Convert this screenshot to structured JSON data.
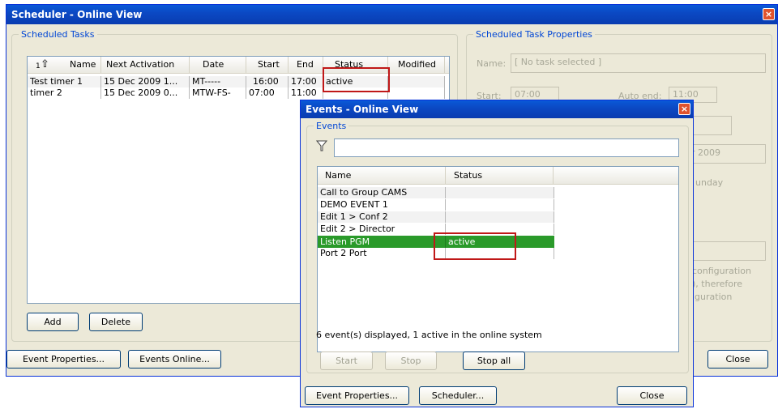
{
  "scheduler": {
    "title": "Scheduler - Online View",
    "tasks_legend": "Scheduled Tasks",
    "columns": [
      "Name",
      "Next Activation",
      "Date",
      "Start",
      "End",
      "Status",
      "Modified"
    ],
    "sort_indicator": "1",
    "rows": [
      {
        "name": "Test timer 1",
        "next": "15 Dec 2009 1...",
        "date": "MT-----",
        "start": "16:00",
        "end": "17:00",
        "status": "active"
      },
      {
        "name": "timer 2",
        "next": "15 Dec 2009 0...",
        "date": "MTW-FS-",
        "start": "07:00",
        "end": "11:00",
        "status": ""
      }
    ],
    "add_label": "Add",
    "delete_label": "Delete",
    "event_props_label": "Event Properties...",
    "events_online_label": "Events Online...",
    "close_label": "Close",
    "props_legend": "Scheduled Task Properties",
    "props_name_label": "Name:",
    "props_name_value": "[ No task selected ]",
    "props_start_label": "Start:",
    "props_start_value": "07:00",
    "props_autoend_label": "Auto end:",
    "props_autoend_value": "11:00",
    "props_year_value": "r 2009",
    "props_day_text": "unday",
    "props_note_1": "configuration",
    "props_note_2": "), therefore",
    "props_note_3": "iguration"
  },
  "events": {
    "title": "Events - Online View",
    "legend": "Events",
    "filter_value": "",
    "columns": [
      "Name",
      "Status"
    ],
    "rows": [
      {
        "name": "Call to Group CAMS",
        "status": ""
      },
      {
        "name": "DEMO EVENT 1",
        "status": ""
      },
      {
        "name": "Edit 1 > Conf 2",
        "status": ""
      },
      {
        "name": "Edit 2 > Director",
        "status": ""
      },
      {
        "name": "Listen PGM",
        "status": "active"
      },
      {
        "name": "Port 2 Port",
        "status": ""
      }
    ],
    "summary": "6 event(s) displayed, 1 active in the online system",
    "start_label": "Start",
    "stop_label": "Stop",
    "stopall_label": "Stop all",
    "event_props_label": "Event Properties...",
    "scheduler_label": "Scheduler...",
    "close_label": "Close",
    "active_row_color": "#2a9a2a"
  }
}
